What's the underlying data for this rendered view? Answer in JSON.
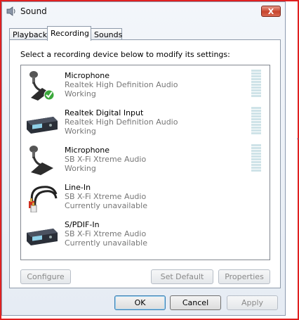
{
  "window": {
    "title": "Sound",
    "close_label": "X"
  },
  "tabs": [
    {
      "label": "Playback",
      "active": false
    },
    {
      "label": "Recording",
      "active": true
    },
    {
      "label": "Sounds",
      "active": false
    }
  ],
  "instruction": "Select a recording device below to modify its settings:",
  "devices": [
    {
      "name": "Microphone",
      "driver": "Realtek High Definition Audio",
      "status": "Working",
      "icon": "microphone-default-icon",
      "meter": true
    },
    {
      "name": "Realtek Digital Input",
      "driver": "Realtek High Definition Audio",
      "status": "Working",
      "icon": "digital-input-device-icon",
      "meter": true
    },
    {
      "name": "Microphone",
      "driver": "SB X-Fi Xtreme Audio",
      "status": "Working",
      "icon": "microphone-icon",
      "meter": true
    },
    {
      "name": "Line-In",
      "driver": "SB X-Fi Xtreme Audio",
      "status": "Currently unavailable",
      "icon": "rca-cable-icon",
      "meter": false
    },
    {
      "name": "S/PDIF-In",
      "driver": "SB X-Fi Xtreme Audio",
      "status": "Currently unavailable",
      "icon": "digital-input-device-icon",
      "meter": false
    }
  ],
  "panel_buttons": {
    "configure": "Configure",
    "set_default": "Set Default",
    "properties": "Properties"
  },
  "dialog_buttons": {
    "ok": "OK",
    "cancel": "Cancel",
    "apply": "Apply"
  },
  "colors": {
    "frame_border": "#e02020",
    "meter": "#cfe3e8",
    "default_check": "#3aa83a"
  }
}
